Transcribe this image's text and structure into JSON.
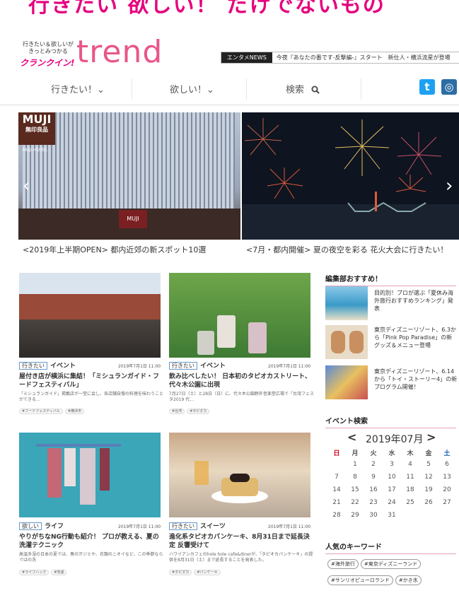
{
  "banner": {
    "text": "行きたい 欲しい！ だけでないもの"
  },
  "logo": {
    "tagline1": "行きたい＆欲しいが",
    "tagline2": "きっとみつかる",
    "brand": "クランクイン!",
    "name": "trend"
  },
  "ticker": {
    "label": "エンタメNEWS",
    "text": "今夜『あなたの番です-反撃編-』スタート　新仕人・横浜流星が登場"
  },
  "nav": {
    "items": [
      "行きたい！⌄",
      "欲しい！⌄",
      "検索"
    ]
  },
  "sns": {
    "twitter": "t",
    "instagram": "◎"
  },
  "slider": {
    "captions": [
      "<2019年上半期OPEN> 都内近郊の新スポット10選",
      "<7月・都内開催> 夏の夜空を彩る 花火大会に行きたい！"
    ],
    "prev": "‹",
    "next": "›",
    "store_sign": "MUJI",
    "store_sub": "無印良品",
    "hotel_sign": "MUJI HOTEL"
  },
  "cards": [
    {
      "badge": "行きたい",
      "category": "イベント",
      "date": "2019年7月1日 11:00",
      "title": "屋付き店が横浜に集結！「ミシュランガイド・フードフェスティバル」",
      "desc": "「ミシュランガイド」掲載店が一堂に会し、各店舗自慢の料理を味わうことができる…",
      "tags": [
        "#フードフェスティバル",
        "#横浜市"
      ]
    },
    {
      "badge": "行きたい",
      "category": "イベント",
      "date": "2019年7月1日 11:00",
      "title": "飲み比べしたい！ 日本初のタピオカストリート、代々木公園に出現",
      "desc": "7月27日（土）と28日（日）に、代々木公園野外音楽堂広場で「台湾フェスタ2019 代…",
      "tags": [
        "#台湾",
        "#タピオカ"
      ]
    },
    {
      "badge": "欲しい",
      "category": "ライフ",
      "date": "2019年7月1日 11:00",
      "title": "やりがちなNG行動も紹介！ プロが教える、夏の洗濯テクニック",
      "desc": "高温多湿の日本の夏では、臭の汗ジミや、衣類のニオイなど、この季節ならではの洗",
      "tags": [
        "#ライフハック",
        "#洗濯"
      ]
    },
    {
      "badge": "行きたい",
      "category": "スイーツ",
      "date": "2019年7月1日 11:00",
      "title": "進化系タピオカパンケーキ、8月31日まで延長決定 反響受けて",
      "desc": "ハワイアンカフェのhole hole cafe&dinerが、「タピオカパンケーキ」の提供を8月31日（土）まで延長することを発表した。",
      "tags": [
        "#タピオカ",
        "#パンケーキ"
      ]
    }
  ],
  "sidebar": {
    "recommend_title": "編集部おすすめ！",
    "recommend": [
      "目的別！プロが選ぶ「夏休み海外旅行おすすめランキング」発表",
      "東京ディズニーリゾート、6.3から「Pink Pop Paradise」の新グッズ＆メニュー登場",
      "東京ディズニーリゾート、6.14から「トイ・ストーリー4」の新プログラム開催！"
    ],
    "event_title": "イベント検索",
    "calendar": {
      "prev": "<",
      "next": ">",
      "month": "2019年07月",
      "weekdays": [
        "日",
        "月",
        "火",
        "水",
        "木",
        "金",
        "土"
      ],
      "weeks": [
        [
          "",
          "1",
          "2",
          "3",
          "4",
          "5",
          "6"
        ],
        [
          "7",
          "8",
          "9",
          "10",
          "11",
          "12",
          "13"
        ],
        [
          "14",
          "15",
          "16",
          "17",
          "18",
          "19",
          "20"
        ],
        [
          "21",
          "22",
          "23",
          "24",
          "25",
          "26",
          "27"
        ],
        [
          "28",
          "29",
          "30",
          "31",
          "",
          "",
          ""
        ]
      ]
    },
    "keywords_title": "人気のキーワード",
    "keywords": [
      "#海外旅行",
      "#東京ディズニーランド",
      "#サンリオピューロランド",
      "#かき氷"
    ]
  },
  "colors": {
    "accent": "#e6007e",
    "trend": "#e8568a",
    "twitter": "#1da1f2",
    "instagram": "#2c6da3",
    "sunday": "#d0021b",
    "saturday": "#1a5fb4"
  }
}
